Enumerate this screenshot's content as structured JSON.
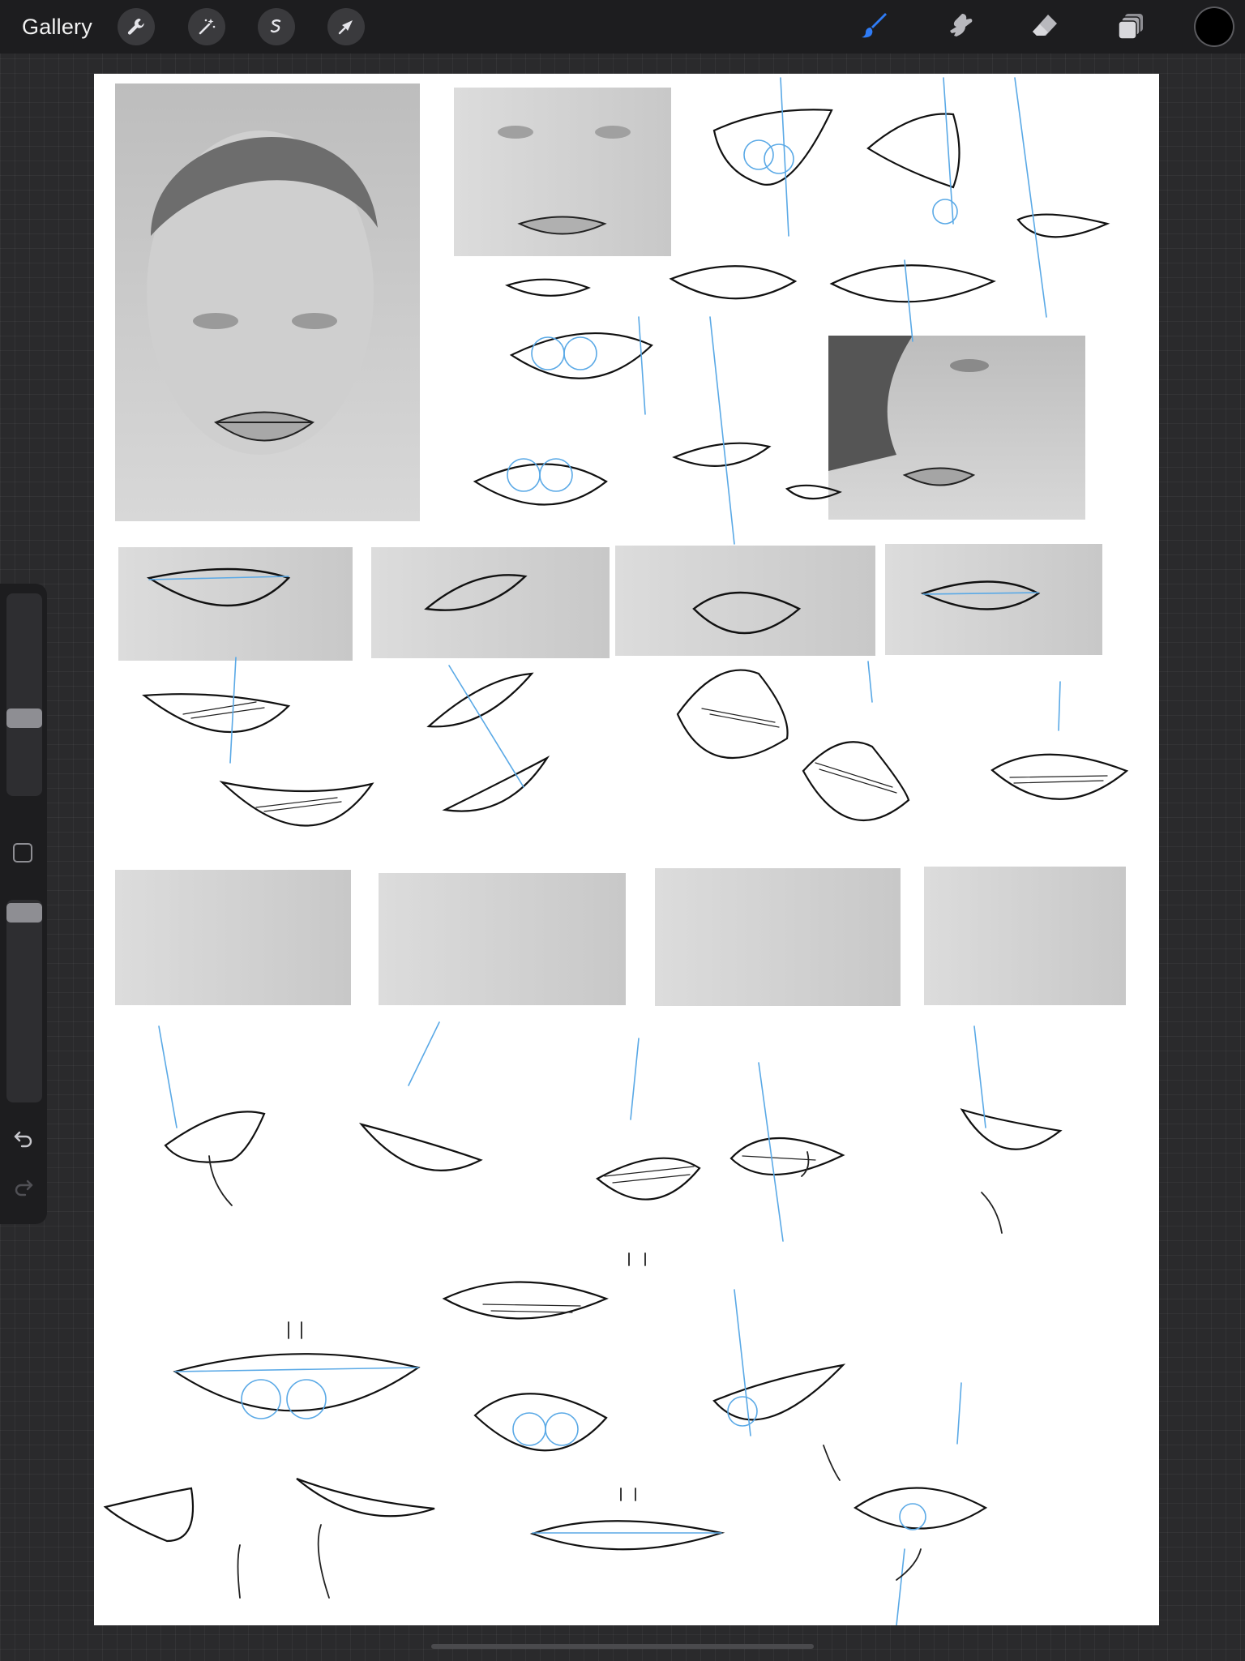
{
  "app": {
    "gallery_label": "Gallery"
  },
  "toolbar_left": [
    {
      "name": "actions-wrench-icon"
    },
    {
      "name": "adjustments-magic-wand-icon"
    },
    {
      "name": "selection-icon"
    },
    {
      "name": "transform-arrow-icon"
    }
  ],
  "toolbar_right": [
    {
      "name": "brush-icon",
      "active": true
    },
    {
      "name": "smudge-icon",
      "active": false
    },
    {
      "name": "eraser-icon",
      "active": false
    },
    {
      "name": "layers-icon",
      "active": false
    }
  ],
  "colors": {
    "accent": "#2f7cf6",
    "current_color": "#000000",
    "construction_lines": "#5aa9e6",
    "ink": "#111111"
  },
  "sidebar": {
    "brush_size_level": 0.45,
    "opacity_level": 0.92,
    "undo_icon": "undo-arrow-icon",
    "redo_icon": "redo-arrow-icon",
    "redo_enabled": false
  }
}
